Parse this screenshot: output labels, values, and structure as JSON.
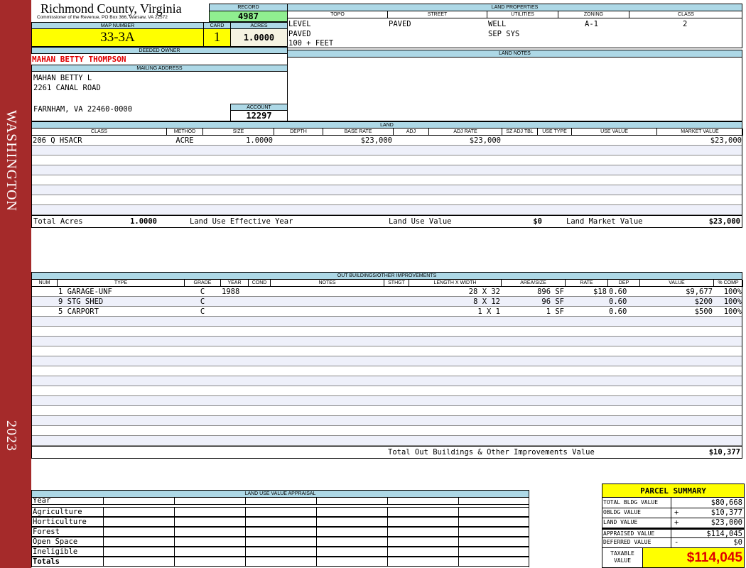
{
  "sidebar": {
    "name": "WASHINGTON",
    "year": "2023"
  },
  "header": {
    "title": "Richmond County, Virginia",
    "subtitle": "Commissioner of the Revenue, PO Box 366, Warsaw, VA 22572",
    "record_label": "RECORD",
    "record": "4987"
  },
  "parcel": {
    "map_label": "MAP NUMBER",
    "map_number": "33-3A",
    "card_label": "CARD",
    "card": "1",
    "acres_label": "ACRES",
    "acres": "1.0000"
  },
  "owner": {
    "deeded_label": "DEEDED OWNER",
    "deeded_owner": "MAHAN BETTY THOMPSON",
    "mailing_label": "MAILING ADDRESS",
    "address": [
      "MAHAN BETTY L",
      "2261 CANAL ROAD",
      "",
      "FARNHAM, VA 22460-0000"
    ],
    "account_label": "ACCOUNT",
    "account": "12297"
  },
  "land_properties": {
    "title": "LAND PROPERTIES",
    "columns": [
      "TOPO",
      "STREET",
      "UTILITIES",
      "ZONING",
      "CLASS"
    ],
    "topo": [
      "LEVEL",
      "PAVED",
      "100 + FEET"
    ],
    "street": [
      "PAVED"
    ],
    "utilities": [
      "WELL",
      "SEP SYS"
    ],
    "zoning": "A-1",
    "class": "2"
  },
  "land_notes": {
    "title": "LAND NOTES"
  },
  "land": {
    "title": "LAND",
    "columns": [
      "CLASS",
      "METHOD",
      "SIZE",
      "DEPTH",
      "BASE RATE",
      "ADJ",
      "ADJ RATE",
      "SZ ADJ TBL",
      "USE TYPE",
      "USE VALUE",
      "MARKET VALUE"
    ],
    "rows": [
      [
        "206 Q HSACR",
        "ACRE",
        "1.0000",
        "",
        "$23,000",
        "",
        "$23,000",
        "",
        "",
        "",
        "$23,000"
      ]
    ],
    "totals": {
      "acres_label": "Total Acres",
      "acres": "1.0000",
      "year_label": "Land Use Effective Year",
      "year": "",
      "use_label": "Land Use Value",
      "use_value": "$0",
      "market_label": "Land Market Value",
      "market_value": "$23,000"
    }
  },
  "outbuildings": {
    "title": "OUT BUILDINGS/OTHER IMPROVEMENTS",
    "columns": [
      "NUM",
      "TYPE",
      "GRADE",
      "YEAR",
      "COND",
      "NOTES",
      "STHGT",
      "LENGTH X WIDTH",
      "AREA/SIZE",
      "RATE",
      "DEP",
      "VALUE",
      "% COMP"
    ],
    "rows": [
      [
        "",
        "1 GARAGE-UNF",
        "C",
        "1988",
        "",
        "",
        "",
        "28 X 32",
        "896 SF",
        "$18",
        "0.60",
        "$9,677",
        "100%"
      ],
      [
        "",
        "9 STG SHED",
        "C",
        "",
        "",
        "",
        "",
        "8 X 12",
        "96 SF",
        "",
        "0.60",
        "$200",
        "100%"
      ],
      [
        "",
        "5 CARPORT",
        "C",
        "",
        "",
        "",
        "",
        "1 X 1",
        "1 SF",
        "",
        "0.60",
        "$500",
        "100%"
      ]
    ],
    "total_label": "Total Out Buildings & Other Improvements Value",
    "total": "$10,377"
  },
  "land_use": {
    "title": "LAND USE VALUE APPRAISAL",
    "year_label": "Year",
    "rows": [
      "Agriculture",
      "Horticulture",
      "Forest",
      "Open Space",
      "Ineligible"
    ],
    "totals_label": "Totals"
  },
  "summary": {
    "title": "PARCEL SUMMARY",
    "rows": [
      {
        "label": "TOTAL BLDG VALUE",
        "op": "",
        "value": "$80,668"
      },
      {
        "label": "OBLDG VALUE",
        "op": "+",
        "value": "$10,377"
      },
      {
        "label": "LAND VALUE",
        "op": "+",
        "value": "$23,000"
      },
      {
        "label": "APPRAISED VALUE",
        "op": "",
        "value": "$114,045"
      },
      {
        "label": "DEFERRED VALUE",
        "op": "-",
        "value": "$0"
      }
    ],
    "taxable_label": "TAXABLE VALUE",
    "taxable": "$114,045"
  },
  "colors": {
    "sidebar": "#a52a2a",
    "header": "#add8e6",
    "highlight": "#ffff00",
    "record": "#90ee90",
    "owner": "#e00000"
  }
}
